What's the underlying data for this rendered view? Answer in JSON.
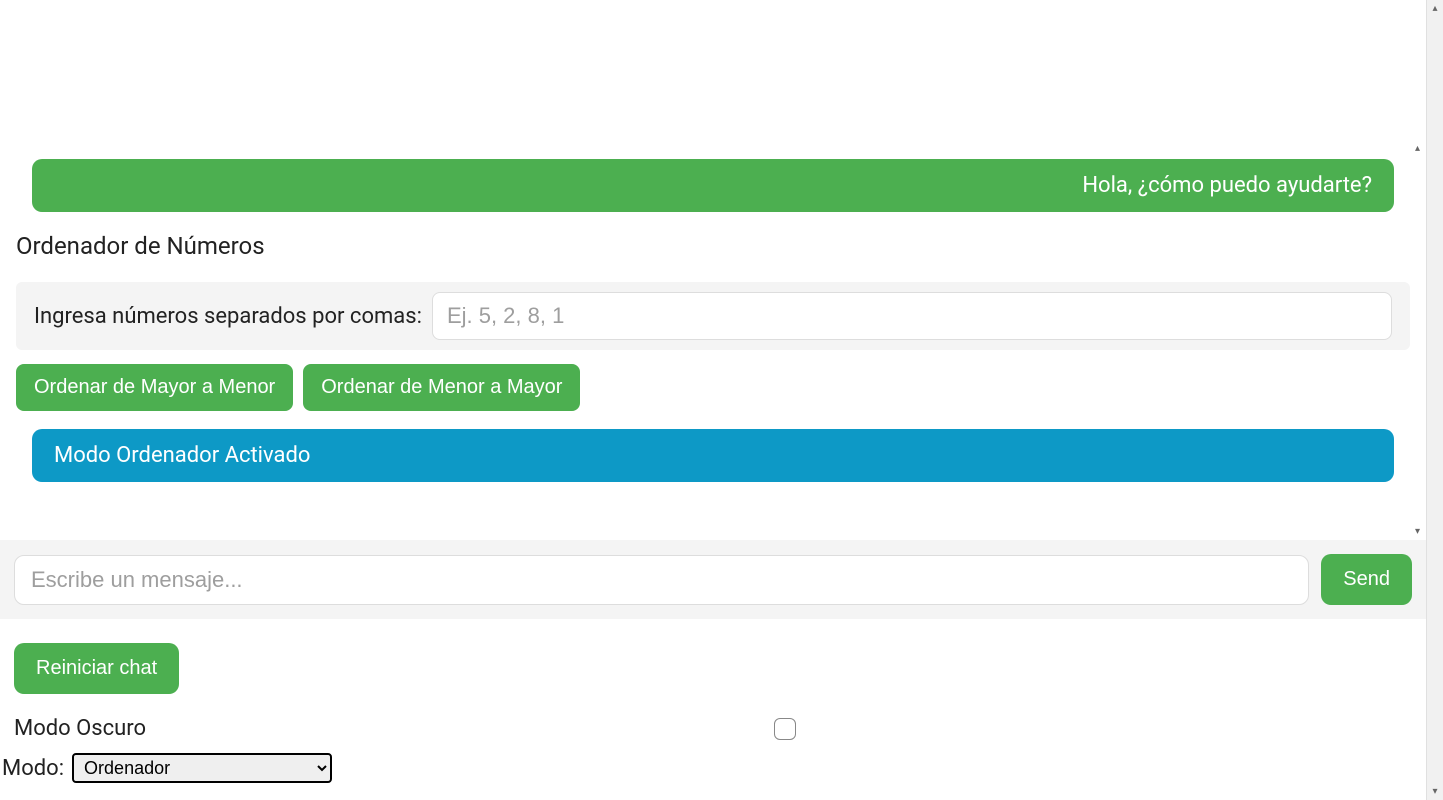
{
  "chat": {
    "greeting": "Hola, ¿cómo puedo ayudarte?",
    "status": "Modo Ordenador Activado"
  },
  "sorter": {
    "title": "Ordenador de Números",
    "input_label": "Ingresa números separados por comas:",
    "input_placeholder": "Ej. 5, 2, 8, 1",
    "btn_desc": "Ordenar de Mayor a Menor",
    "btn_asc": "Ordenar de Menor a Mayor"
  },
  "compose": {
    "placeholder": "Escribe un mensaje...",
    "send": "Send"
  },
  "controls": {
    "reset": "Reiniciar chat",
    "dark_mode_label": "Modo Oscuro",
    "mode_label": "Modo:",
    "mode_selected": "Ordenador"
  }
}
